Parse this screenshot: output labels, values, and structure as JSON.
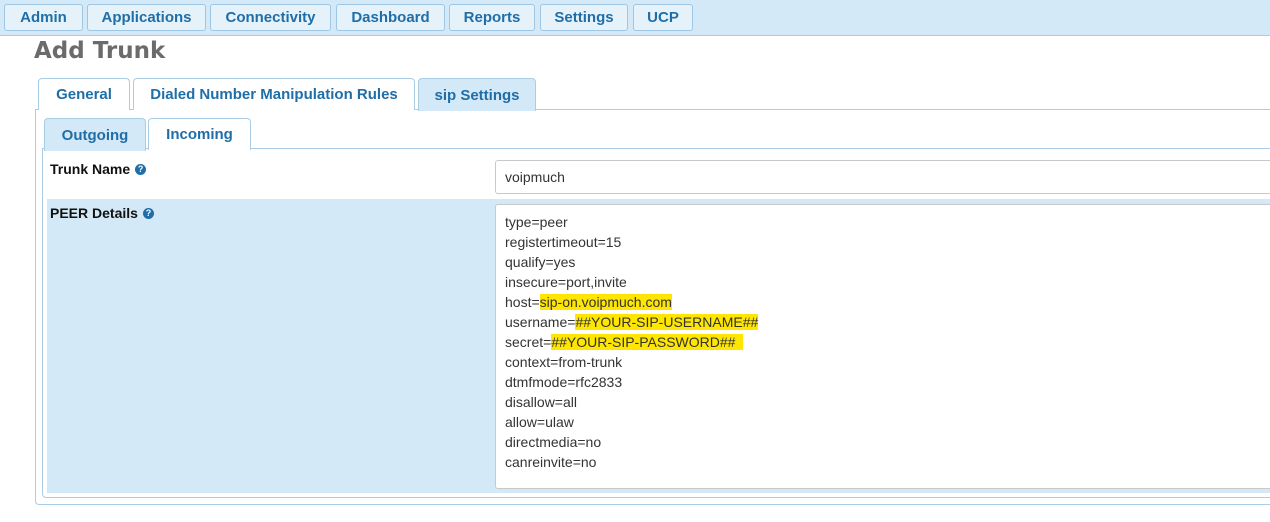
{
  "nav": {
    "items": [
      {
        "label": "Admin"
      },
      {
        "label": "Applications"
      },
      {
        "label": "Connectivity"
      },
      {
        "label": "Dashboard"
      },
      {
        "label": "Reports"
      },
      {
        "label": "Settings"
      },
      {
        "label": "UCP"
      }
    ]
  },
  "page": {
    "title": "Add Trunk"
  },
  "tabs": [
    {
      "label": "General"
    },
    {
      "label": "Dialed Number Manipulation Rules"
    },
    {
      "label": "sip Settings"
    }
  ],
  "subtabs": [
    {
      "label": "Outgoing"
    },
    {
      "label": "Incoming"
    }
  ],
  "form": {
    "trunk_name_label": "Trunk Name",
    "trunk_name_value": "voipmuch",
    "peer_details_label": "PEER Details",
    "help_glyph": "?",
    "peer_lines": [
      {
        "key": "type=peer",
        "hl": ""
      },
      {
        "key": "registertimeout=15",
        "hl": ""
      },
      {
        "key": "qualify=yes",
        "hl": ""
      },
      {
        "key": "insecure=port,invite",
        "hl": ""
      },
      {
        "key": "host=",
        "hl": "sip-on.voipmuch.com"
      },
      {
        "key": "username=",
        "hl": "##YOUR-SIP-USERNAME##"
      },
      {
        "key": "secret=",
        "hl": "##YOUR-SIP-PASSWORD##  "
      },
      {
        "key": "context=from-trunk",
        "hl": ""
      },
      {
        "key": "dtmfmode=rfc2833",
        "hl": ""
      },
      {
        "key": "disallow=all",
        "hl": ""
      },
      {
        "key": "allow=ulaw",
        "hl": ""
      },
      {
        "key": "directmedia=no",
        "hl": ""
      },
      {
        "key": "canreinvite=no",
        "hl": ""
      }
    ]
  },
  "colors": {
    "nav_bg": "#d4e9f7",
    "link_blue": "#1f6ea8",
    "highlight": "#ffe600"
  },
  "icons": {
    "help": "help-circle-icon"
  }
}
